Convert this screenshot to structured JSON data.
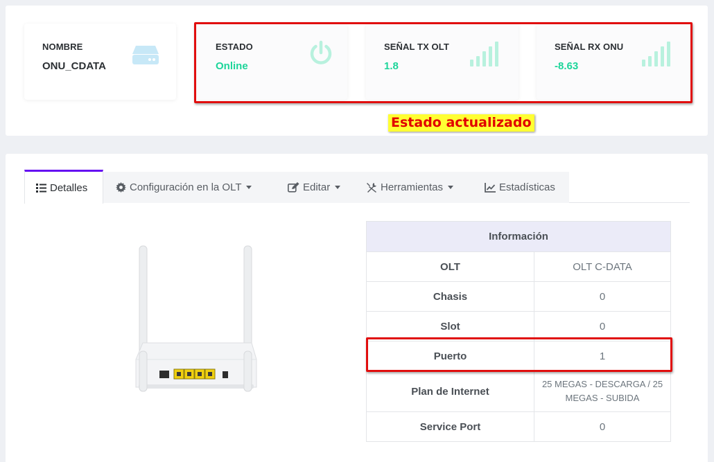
{
  "cards": {
    "nombre": {
      "label": "NOMBRE",
      "value": "ONU_CDATA",
      "icon": "hard-drive-icon"
    },
    "estado": {
      "label": "ESTADO",
      "value": "Online",
      "icon": "power-icon"
    },
    "tx": {
      "label": "SEÑAL TX OLT",
      "value": "1.8",
      "icon": "signal-bars-icon"
    },
    "rx": {
      "label": "SEÑAL RX ONU",
      "value": "-8.63",
      "icon": "signal-bars-icon"
    }
  },
  "callout": "Estado actualizado",
  "tabs": [
    {
      "label": "Detalles",
      "icon": "list-icon",
      "active": true
    },
    {
      "label": "Configuración en la OLT",
      "icon": "gear-icon",
      "dropdown": true
    },
    {
      "label": "Editar",
      "icon": "edit-icon",
      "dropdown": true
    },
    {
      "label": "Herramientas",
      "icon": "tools-icon",
      "dropdown": true
    },
    {
      "label": "Estadísticas",
      "icon": "chart-line-icon"
    }
  ],
  "info": {
    "title": "Información",
    "rows": [
      {
        "key": "OLT",
        "value": "OLT C-DATA"
      },
      {
        "key": "Chasis",
        "value": "0"
      },
      {
        "key": "Slot",
        "value": "0"
      },
      {
        "key": "Puerto",
        "value": "1"
      },
      {
        "key": "Plan de Internet",
        "value": "25 MEGAS - DESCARGA / 25 MEGAS - SUBIDA"
      },
      {
        "key": "Service Port",
        "value": "0"
      }
    ]
  },
  "colors": {
    "accent": "#6610f2",
    "online": "#1dd59a",
    "highlight": "#e10e0e",
    "callout_bg": "#ffff33"
  }
}
